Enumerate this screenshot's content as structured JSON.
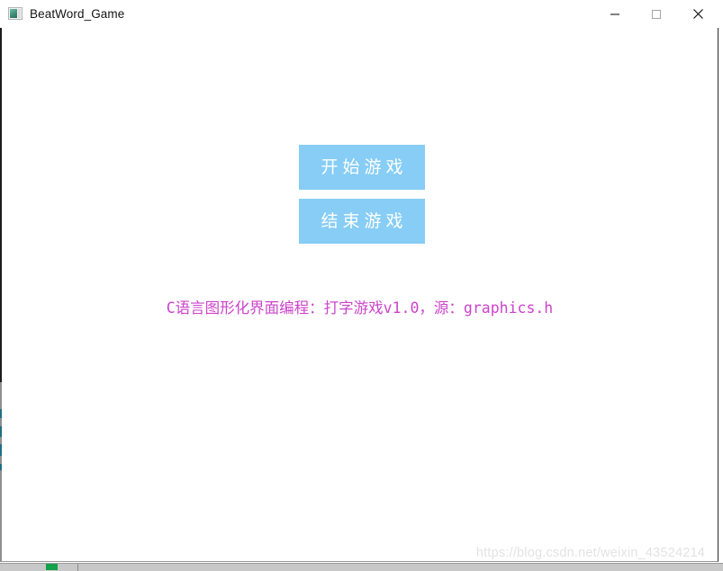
{
  "window": {
    "title": "BeatWord_Game",
    "icon": "app-window-icon",
    "controls": {
      "minimize": "minimize-icon",
      "maximize": "maximize-icon",
      "close": "close-icon"
    }
  },
  "buttons": {
    "start_game": "开始游戏",
    "end_game": "结束游戏",
    "fill_color": "#87cdf5",
    "text_color": "#ffffff"
  },
  "credit": {
    "text": "C语言图形化界面编程：打字游戏v1.0，源：graphics.h",
    "color": "#cc44cc"
  },
  "watermark": {
    "text": "https://blog.csdn.net/weixin_43524214",
    "color": "#e3e3e3"
  },
  "taskbar": {
    "tile_color": "#13a24a",
    "background": "#c8c8c8"
  },
  "left_border": {
    "base_color": "#1c1c1c",
    "accent_color": "#1f6f87",
    "gray_color": "#8f8f8f"
  }
}
